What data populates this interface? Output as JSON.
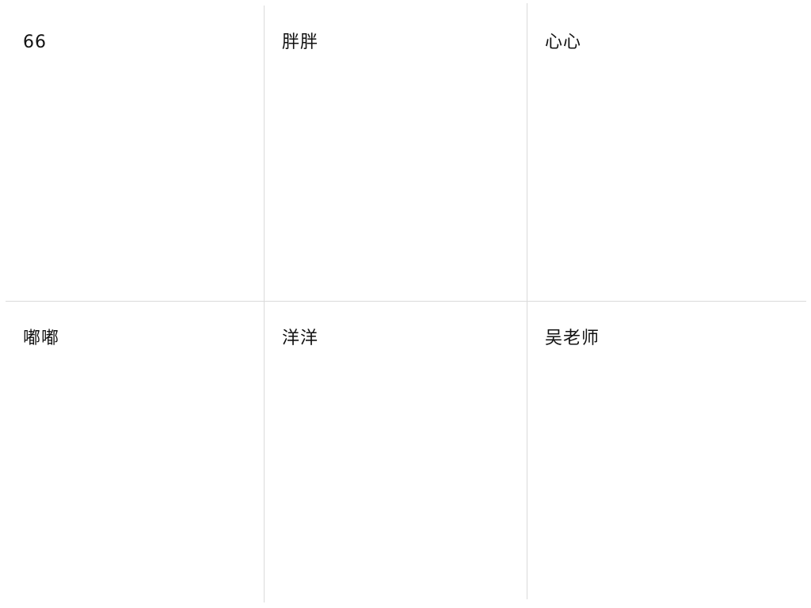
{
  "participants": [
    {
      "name": "66"
    },
    {
      "name": "胖胖"
    },
    {
      "name": "心心"
    },
    {
      "name": "嘟嘟"
    },
    {
      "name": "洋洋"
    },
    {
      "name": "吴老师"
    }
  ],
  "colors": {
    "background": "#ffffff",
    "divider": "#dadada",
    "text": "#111111"
  }
}
